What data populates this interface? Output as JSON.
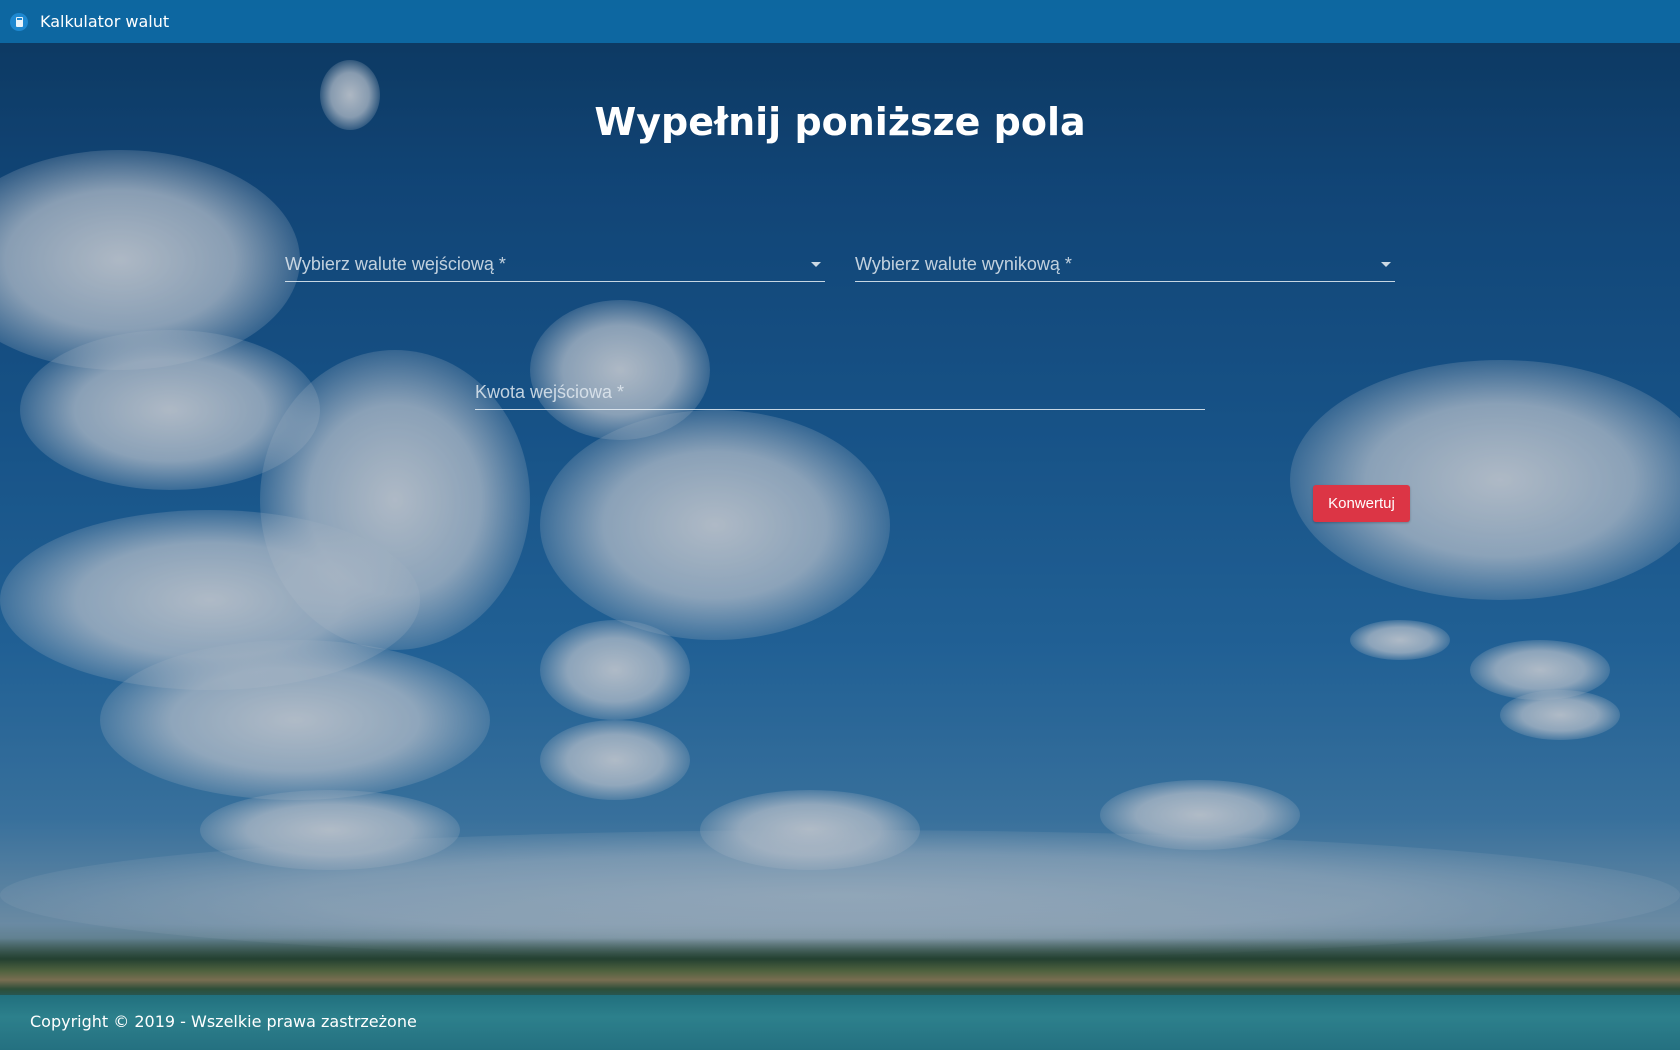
{
  "window": {
    "title": "Kalkulator walut",
    "icon": "calculator-icon"
  },
  "main": {
    "heading": "Wypełnij poniższe pola",
    "source_currency_label": "Wybierz walute wejściową *",
    "target_currency_label": "Wybierz walute wynikową *",
    "amount_label": "Kwota wejściowa *",
    "convert_button": "Konwertuj"
  },
  "footer": {
    "copyright": "Copyright © 2019 - Wszelkie prawa zastrzeżone"
  },
  "colors": {
    "titlebar": "#0e6aa6",
    "button": "#dc3545"
  }
}
